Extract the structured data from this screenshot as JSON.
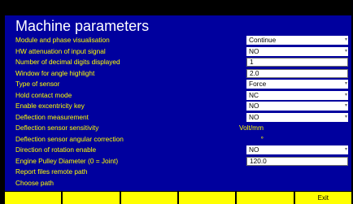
{
  "title": "Machine parameters",
  "rows": [
    {
      "label": "Module and phase visualisation",
      "unit": "",
      "value": "Continue",
      "type": "select"
    },
    {
      "label": "HW attenuation of input signal",
      "unit": "",
      "value": "NO",
      "type": "select"
    },
    {
      "label": "Number of decimal digits displayed",
      "unit": "",
      "value": "1",
      "type": "input"
    },
    {
      "label": "Window for angle highlight",
      "unit": "°",
      "value": "2.0",
      "type": "input"
    },
    {
      "label": "Type of sensor",
      "unit": "",
      "value": "Force",
      "type": "select"
    },
    {
      "label": "Hold contact mode",
      "unit": "",
      "value": "NC",
      "type": "select"
    },
    {
      "label": "Enable excentricity key",
      "unit": "",
      "value": "NO",
      "type": "select"
    },
    {
      "label": "Deflection measurement",
      "unit": "",
      "value": "NO",
      "type": "select"
    },
    {
      "label": "Deflection sensor sensitivity",
      "unit": "Volt/mm",
      "value": "",
      "type": "readonly"
    },
    {
      "label": "Deflection sensor angular correction",
      "unit": "°",
      "value": "",
      "type": "readonly"
    },
    {
      "label": "Direction of rotation enable",
      "unit": "",
      "value": "NO",
      "type": "select"
    },
    {
      "label": "Engine Pulley Diameter (0 = Joint)",
      "unit": "mm",
      "value": "120.0",
      "type": "input"
    },
    {
      "label": "Report files remote path",
      "unit": "",
      "value": "",
      "type": "readonly"
    },
    {
      "label": "Choose path",
      "unit": "",
      "value": "",
      "type": "none"
    }
  ],
  "softkeys": [
    "",
    "",
    "",
    "",
    "",
    "Exit"
  ],
  "colors": {
    "panel": "#00009e",
    "label": "#ffff00",
    "softkey": "#ffff00"
  }
}
